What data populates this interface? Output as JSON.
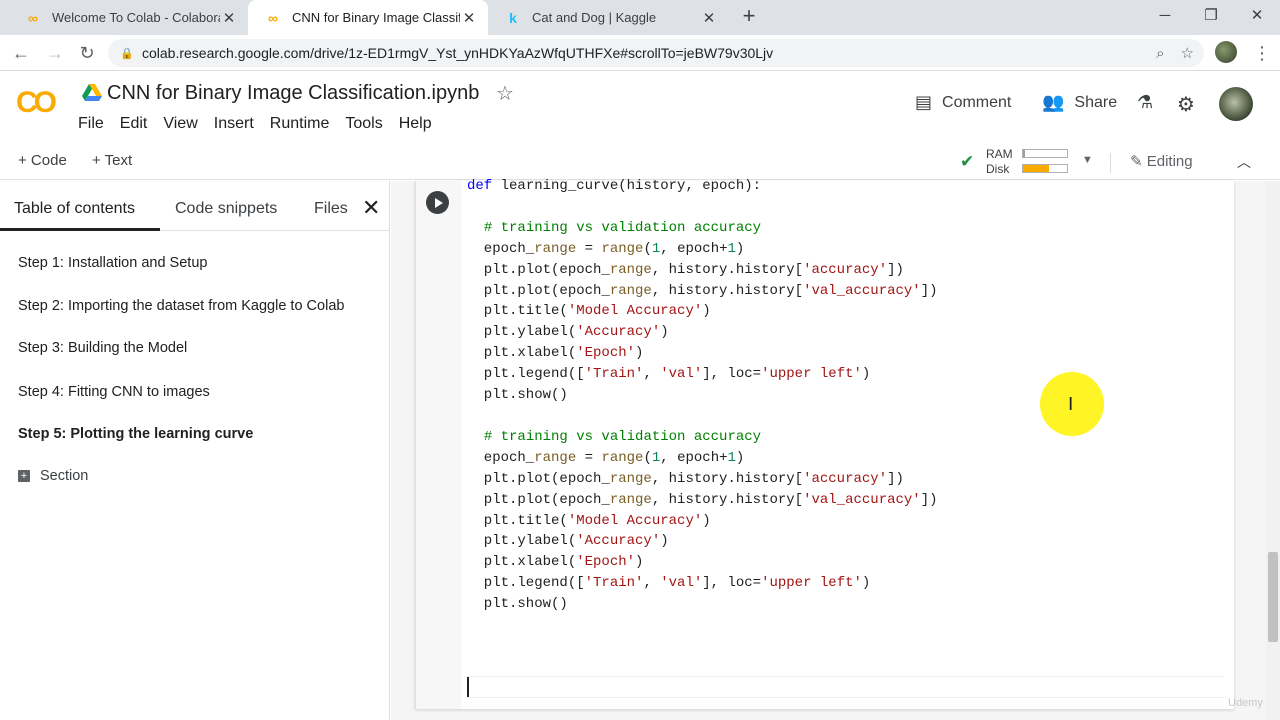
{
  "browser": {
    "tabs": [
      {
        "title": "Welcome To Colab - Colaborator",
        "favicon": "colab-icon"
      },
      {
        "title": "CNN for Binary Image Classificati",
        "favicon": "colab-icon"
      },
      {
        "title": "Cat and Dog | Kaggle",
        "favicon": "kaggle-icon",
        "favicon_text": "k"
      }
    ],
    "url": "colab.research.google.com/drive/1z-ED1rmgV_Yst_ynHDKYaAzWfqUTHFXe#scrollTo=jeBW79v30Ljv"
  },
  "colab": {
    "logo": "CO",
    "title": "CNN for Binary Image Classification.ipynb",
    "menu": [
      "File",
      "Edit",
      "View",
      "Insert",
      "Runtime",
      "Tools",
      "Help"
    ],
    "comment_label": "Comment",
    "share_label": "Share",
    "add_code_label": "+ Code",
    "add_text_label": "+ Text",
    "ram_label": "RAM",
    "disk_label": "Disk",
    "ram_usage": 0.05,
    "disk_usage": 0.6,
    "editing_label": "Editing"
  },
  "sidebar": {
    "tabs": [
      "Table of contents",
      "Code snippets",
      "Files"
    ],
    "toc": [
      {
        "label": "Step 1: Installation and Setup",
        "bold": false
      },
      {
        "label": "Step 2: Importing the dataset from Kaggle to Colab",
        "bold": false
      },
      {
        "label": "Step 3: Building the Model",
        "bold": false
      },
      {
        "label": "Step 4: Fitting CNN to images",
        "bold": false
      },
      {
        "label": "Step 5: Plotting the learning curve",
        "bold": true
      }
    ],
    "section_label": "Section"
  },
  "code_lines": [
    "def learning_curve(history, epoch):",
    "",
    "  # training vs validation accuracy",
    "  epoch_range = range(1, epoch+1)",
    "  plt.plot(epoch_range, history.history['accuracy'])",
    "  plt.plot(epoch_range, history.history['val_accuracy'])",
    "  plt.title('Model Accuracy')",
    "  plt.ylabel('Accuracy')",
    "  plt.xlabel('Epoch')",
    "  plt.legend(['Train', 'val'], loc='upper left')",
    "  plt.show()",
    "",
    "  # training vs validation accuracy",
    "  epoch_range = range(1, epoch+1)",
    "  plt.plot(epoch_range, history.history['accuracy'])",
    "  plt.plot(epoch_range, history.history['val_accuracy'])",
    "  plt.title('Model Accuracy')",
    "  plt.ylabel('Accuracy')",
    "  plt.xlabel('Epoch')",
    "  plt.legend(['Train', 'val'], loc='upper left')",
    "  plt.show()"
  ],
  "watermark": "Udemy",
  "colors": {
    "colab_orange": "#f9ab00",
    "disk_fill": "#f9ab00",
    "check_green": "#1e8e3e",
    "comment_green": "#008000",
    "keyword_blue": "#0000ff",
    "string_red": "#a31515"
  }
}
